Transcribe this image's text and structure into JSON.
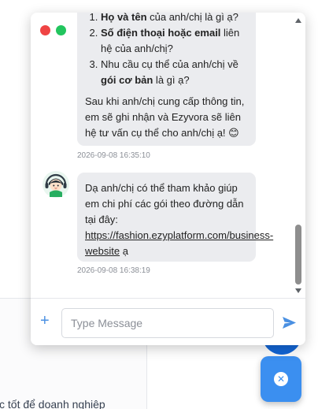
{
  "chat": {
    "message1": {
      "items": [
        {
          "bold": "Họ và tên",
          "rest": " của anh/chị là gì ạ?"
        },
        {
          "bold": "Số điện thoại hoặc email",
          "rest": " liên hệ của anh/chị?"
        },
        {
          "pre": "Nhu cầu cụ thể của anh/chị về ",
          "bold": "gói cơ bản",
          "rest": " là gì ạ?"
        }
      ],
      "paragraph": "Sau khi anh/chị cung cấp thông tin, em sẽ ghi nhận và Ezyvora sẽ liên hệ tư vấn cụ thể cho anh/chị ạ! 😊",
      "timestamp": "2026-09-08 16:35:10"
    },
    "message2": {
      "text": "Dạ anh/chị có thể tham khảo giúp em chi phí các gói theo đường dẫn tại đây:",
      "link": "https://fashion.ezyplatform.com/business-website",
      "suffix": " ạ",
      "timestamp": "2026-09-08 16:38:19"
    },
    "input": {
      "placeholder": "Type Message",
      "value": ""
    }
  },
  "background": {
    "partial_text": "c tốt để doanh nghiệp"
  },
  "icons": {
    "close_window": "red-dot-icon",
    "maximize_window": "green-dot-icon",
    "avatar": "support-agent-avatar-icon",
    "attach": "plus-icon",
    "send": "send-icon",
    "fab_close": "close-icon"
  },
  "colors": {
    "accent": "#3b8ff0",
    "bubble": "#ebecef",
    "timestamp": "#8b8f97"
  }
}
